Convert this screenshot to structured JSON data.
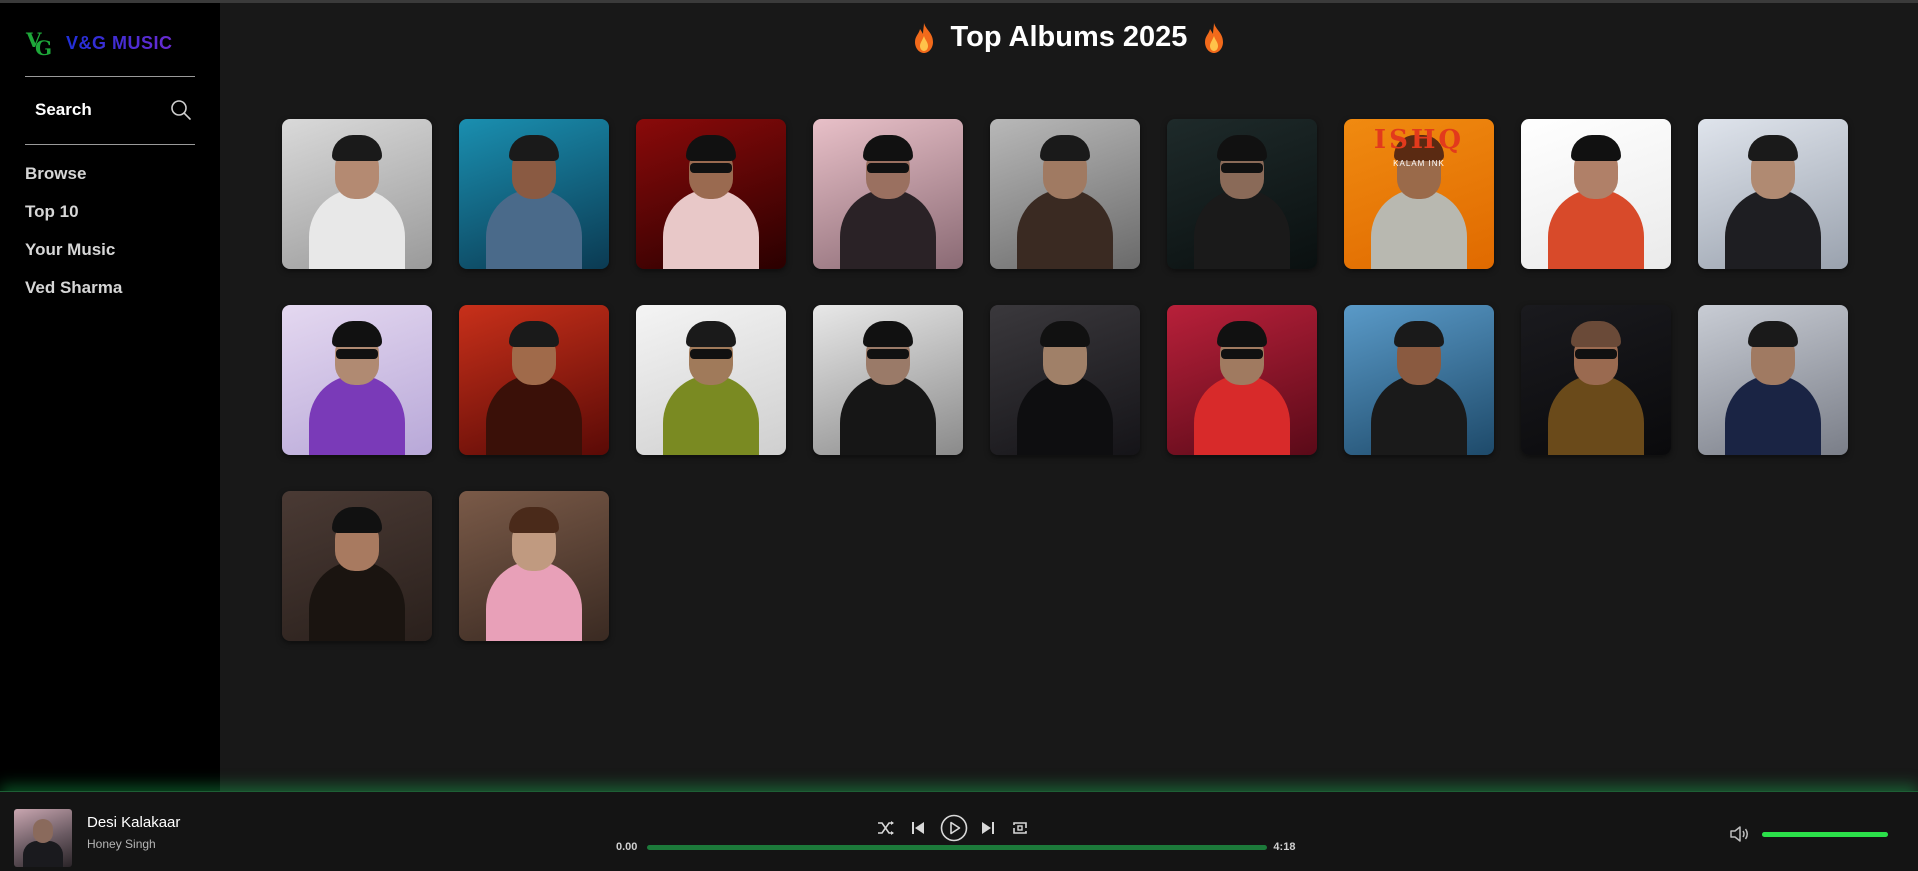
{
  "app": {
    "brand": "V&G MUSIC",
    "accent_color": "#1ed760",
    "background_color": "#181818"
  },
  "sidebar": {
    "search_label": "Search",
    "nav_items": [
      {
        "label": "Browse"
      },
      {
        "label": "Top 10"
      },
      {
        "label": "Your Music"
      },
      {
        "label": "Ved Sharma"
      }
    ]
  },
  "main": {
    "title": "Top Albums 2025",
    "title_icon": "fire-icon",
    "albums": [
      {
        "bg": "linear-gradient(160deg,#d9d9d9,#9a9a9a)",
        "skin": "#b48a72",
        "hair": "#1a1a1a",
        "cloth": "#e8e8e8",
        "glasses": false
      },
      {
        "bg": "linear-gradient(160deg,#1a8fb0,#0b3a52)",
        "skin": "#8a5a42",
        "hair": "#1a1a1a",
        "cloth": "#4a6a8a",
        "glasses": false
      },
      {
        "bg": "linear-gradient(160deg,#8a0a0a,#2a0000)",
        "skin": "#9a6a50",
        "hair": "#111",
        "cloth": "#e8c8c8",
        "glasses": true
      },
      {
        "bg": "linear-gradient(160deg,#e8c0c8,#8a6a74)",
        "skin": "#9a7060",
        "hair": "#111",
        "cloth": "#2a2226",
        "glasses": true
      },
      {
        "bg": "linear-gradient(160deg,#b8b8b8,#6a6a6a)",
        "skin": "#a07a62",
        "hair": "#1a1a1a",
        "cloth": "#3a2a22",
        "glasses": false
      },
      {
        "bg": "linear-gradient(160deg,#1e2a2a,#0a1010)",
        "skin": "#8a6a58",
        "hair": "#111",
        "cloth": "#1a1a1a",
        "glasses": true
      },
      {
        "bg": "linear-gradient(160deg,#f08a10,#e06a00)",
        "skin": "#9a6a4a",
        "hair": "#5a2a12",
        "cloth": "#b8b8b0",
        "glasses": false,
        "cover_title": "ISHQ",
        "cover_sub": "KALAM INK"
      },
      {
        "bg": "linear-gradient(160deg,#ffffff,#eaeaea)",
        "skin": "#b08068",
        "hair": "#111",
        "cloth": "#d84a2a",
        "glasses": false
      },
      {
        "bg": "linear-gradient(160deg,#dfe4ec,#9aa2ae)",
        "skin": "#b08a72",
        "hair": "#1a1a1a",
        "cloth": "#1e1e22",
        "glasses": false
      },
      {
        "bg": "linear-gradient(160deg,#e4d8f0,#b8a8d8)",
        "skin": "#b08a72",
        "hair": "#111",
        "cloth": "#7a3ab8",
        "glasses": true
      },
      {
        "bg": "linear-gradient(160deg,#c8301a,#5a0a06)",
        "skin": "#a06a4a",
        "hair": "#1a1a1a",
        "cloth": "#3a1008",
        "glasses": false
      },
      {
        "bg": "linear-gradient(160deg,#f4f4f4,#cfcfcf)",
        "skin": "#a07a5a",
        "hair": "#1a1a1a",
        "cloth": "#7a8a22",
        "glasses": true
      },
      {
        "bg": "linear-gradient(160deg,#e8e8e8,#8a8a8a)",
        "skin": "#9a7a68",
        "hair": "#111",
        "cloth": "#161616",
        "glasses": true
      },
      {
        "bg": "linear-gradient(160deg,#3a383c,#151418)",
        "skin": "#a08068",
        "hair": "#111",
        "cloth": "#0e0e10",
        "glasses": false
      },
      {
        "bg": "linear-gradient(160deg,#b8203a,#5a0a18)",
        "skin": "#a07a60",
        "hair": "#111",
        "cloth": "#d82a2a",
        "glasses": true
      },
      {
        "bg": "linear-gradient(160deg,#5a9ac8,#1e4a6a)",
        "skin": "#8a5a40",
        "hair": "#1a1a1a",
        "cloth": "#1a1a1a",
        "glasses": false
      },
      {
        "bg": "linear-gradient(160deg,#1a1a1e,#0a0a0c)",
        "skin": "#9a6a50",
        "hair": "#6a4a38",
        "cloth": "#6a4a1a",
        "glasses": true
      },
      {
        "bg": "linear-gradient(160deg,#c8ccd4,#7a7e88)",
        "skin": "#a07a62",
        "hair": "#1a1a1a",
        "cloth": "#1a2444",
        "glasses": false
      },
      {
        "bg": "linear-gradient(160deg,#4a3a34,#2a201c)",
        "skin": "#a87a60",
        "hair": "#111",
        "cloth": "#1a1410",
        "glasses": false
      },
      {
        "bg": "linear-gradient(160deg,#7a5a48,#3a2a22)",
        "skin": "#c09a80",
        "hair": "#4a2a1a",
        "cloth": "#e8a0b8",
        "glasses": false
      }
    ]
  },
  "player": {
    "track_title": "Desi Kalakaar",
    "track_artist": "Honey Singh",
    "current_time": "0.00",
    "duration": "4:18",
    "progress": 0.0,
    "volume": 1.0,
    "controls": [
      "shuffle-icon",
      "previous-icon",
      "play-icon",
      "next-icon",
      "repeat-icon"
    ]
  }
}
